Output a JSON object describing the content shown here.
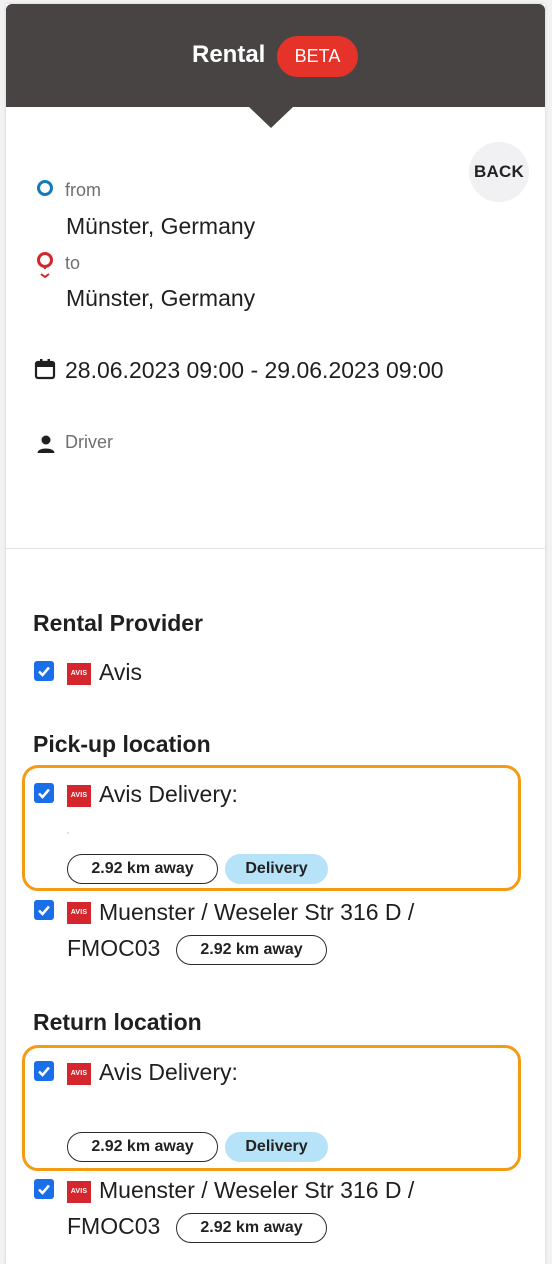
{
  "header": {
    "title": "Rental",
    "badge": "BETA"
  },
  "back_label": "BACK",
  "trip": {
    "from_label": "from",
    "from_value": "Münster, Germany",
    "to_label": "to",
    "to_value": "Münster, Germany",
    "dates": "28.06.2023 09:00 - 29.06.2023 09:00",
    "driver_label": "Driver"
  },
  "rental_provider": {
    "title": "Rental Provider",
    "items": [
      {
        "logo": "AVIS",
        "name": "Avis",
        "checked": true
      }
    ]
  },
  "pickup": {
    "title": "Pick-up location",
    "items": [
      {
        "logo": "AVIS",
        "name": "Avis Delivery:",
        "distance": "2.92 km away",
        "tag": "Delivery",
        "checked": true,
        "highlighted": true
      },
      {
        "logo": "AVIS",
        "name_line1": "Muenster / Weseler Str 316 D /",
        "name_line2": "FMOC03",
        "distance": "2.92 km away",
        "checked": true
      }
    ]
  },
  "return": {
    "title": "Return location",
    "items": [
      {
        "logo": "AVIS",
        "name": "Avis Delivery:",
        "distance": "2.92 km away",
        "tag": "Delivery",
        "checked": true,
        "highlighted": true
      },
      {
        "logo": "AVIS",
        "name_line1": "Muenster / Weseler Str 316 D /",
        "name_line2": "FMOC03",
        "distance": "2.92 km away",
        "checked": true
      }
    ]
  },
  "colors": {
    "header_bg": "#484444",
    "badge_bg": "#e5332a",
    "checkbox": "#1a6fe8",
    "highlight": "#f59b12",
    "delivery_tag": "#b6e3f7",
    "avis_red": "#d4262c"
  },
  "icons": {
    "from": "circle-outline-icon",
    "to": "map-pin-icon",
    "dates": "calendar-icon",
    "driver": "person-icon",
    "check": "checkmark-icon"
  }
}
